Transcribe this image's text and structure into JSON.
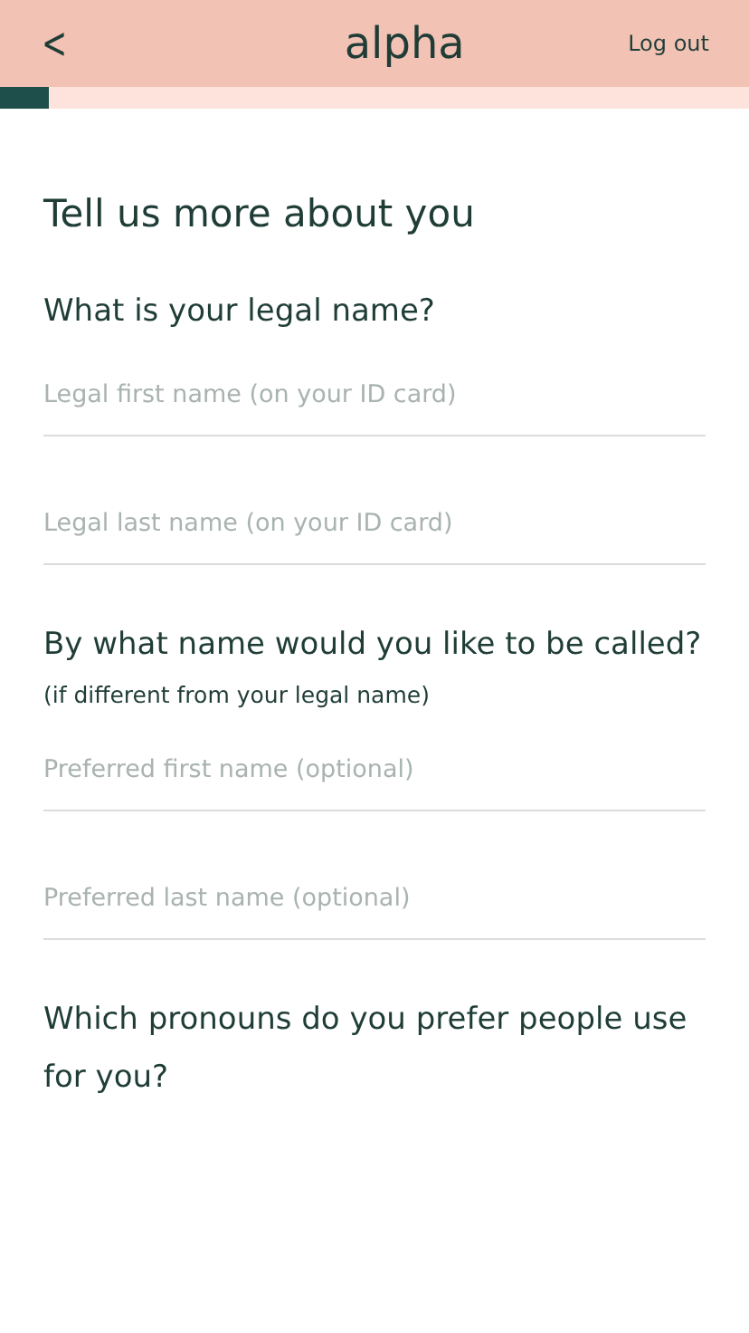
{
  "header": {
    "back": "<",
    "logo": "alpha",
    "logout": "Log out"
  },
  "progress": {
    "level": 0.065
  },
  "title": "Tell us more about you",
  "sections": [
    {
      "question": "What is your legal name?",
      "fields": [
        {
          "placeholder": "Legal first name (on your ID card)"
        },
        {
          "placeholder": "Legal last name (on your ID card)"
        }
      ]
    },
    {
      "question": "By what name would you like to be called?",
      "hint": "(if different from your legal name)",
      "fields": [
        {
          "placeholder": "Preferred first name (optional)"
        },
        {
          "placeholder": "Preferred last name (optional)"
        }
      ]
    },
    {
      "question": "Which pronouns do you prefer people use for you?"
    }
  ]
}
